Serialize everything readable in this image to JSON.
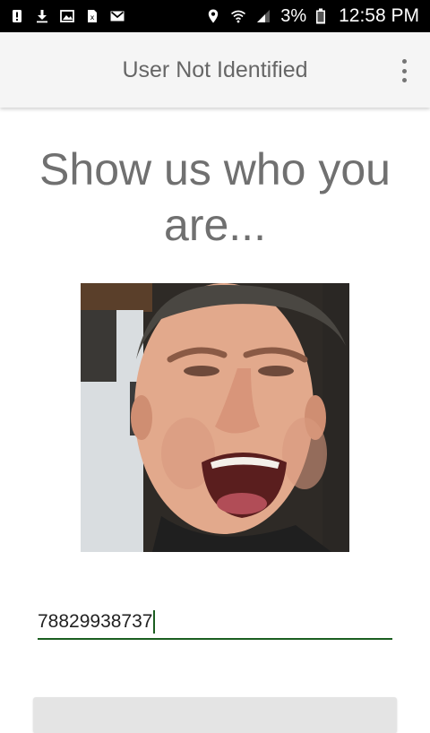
{
  "status_bar": {
    "icons_left": [
      "alert-icon",
      "download-icon",
      "image-icon",
      "sim-card-icon",
      "gmail-icon"
    ],
    "icons_right": [
      "location-icon",
      "wifi-icon",
      "signal-icon",
      "battery-icon"
    ],
    "battery_text": "3%",
    "time": "12:58 PM"
  },
  "app_bar": {
    "title": "User Not Identified",
    "overflow_icon": "more-vert-icon"
  },
  "main": {
    "headline_line1": "Show us who you",
    "headline_line2": "are...",
    "photo_icon": "face-photo",
    "id_input_value": "78829938737"
  },
  "colors": {
    "status_bar_bg": "#000000",
    "app_bar_bg": "#f5f5f5",
    "headline": "#707070",
    "input_underline": "#1b5e20"
  }
}
